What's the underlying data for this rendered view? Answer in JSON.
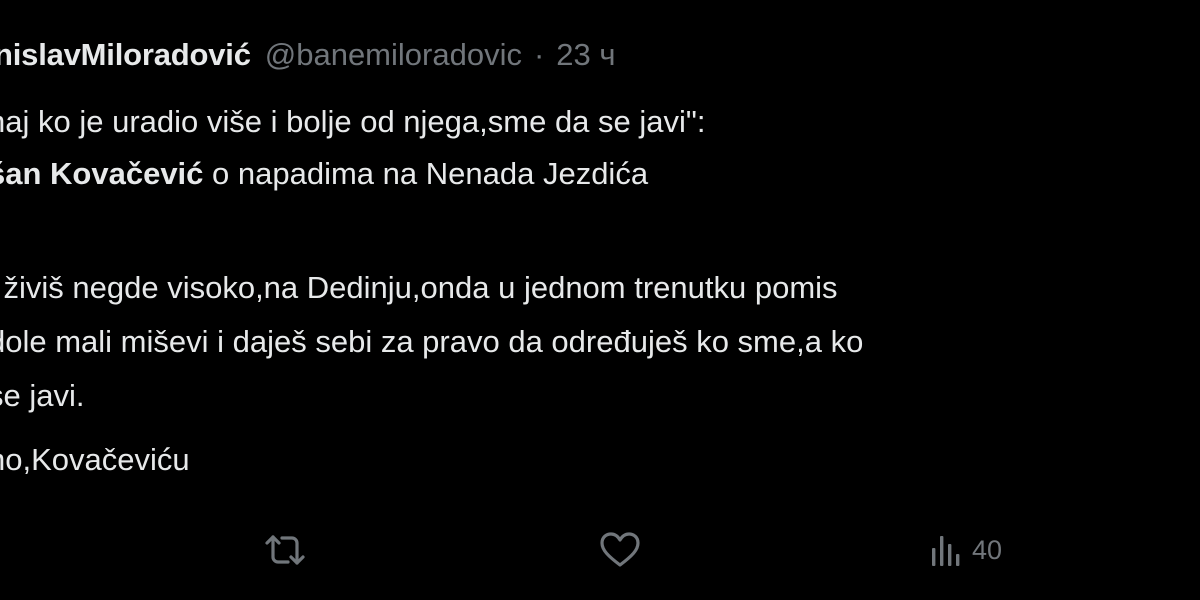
{
  "tweet": {
    "author": {
      "display_name": "nislavMiloradović",
      "handle": "@banemiloradovic",
      "separator": "·",
      "time": "23 ч"
    },
    "lines": [
      {
        "plain": "naj ko je uradio više i bolje od njega,sme da se javi\":"
      },
      {
        "bold": "šan Kovačević",
        "rest": " o napadima na Nenada Jezdića"
      },
      {
        "plain": "l živiš negde visoko,na Dedinju,onda u jednom trenutku pomis"
      },
      {
        "plain": "dole mali miševi i daješ sebi za pravo da određuješ ko sme,a ko"
      },
      {
        "plain": "se javi."
      },
      {
        "plain": "no,Kovačeviću"
      }
    ],
    "actions": {
      "retweet_icon": "retweet-icon",
      "like_icon": "heart-icon",
      "views_icon": "views-bar-chart-icon",
      "views_count": "40"
    }
  }
}
